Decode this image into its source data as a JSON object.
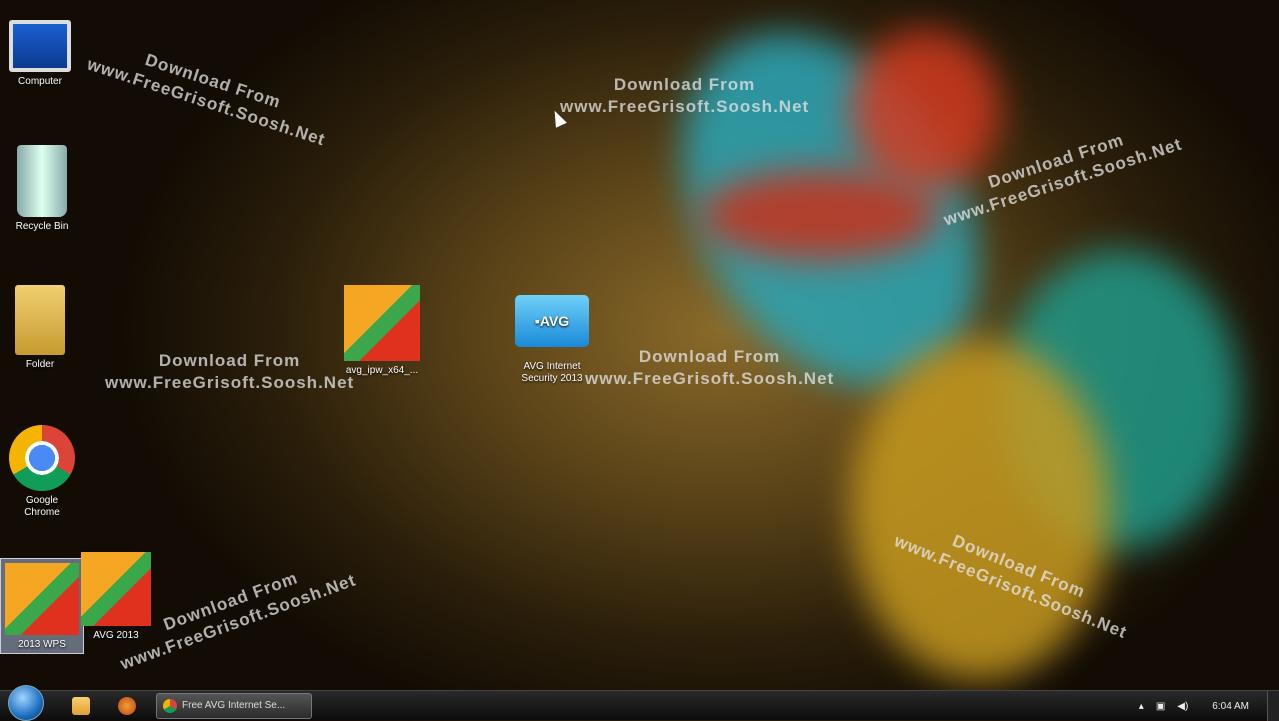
{
  "desktop": {
    "icons": [
      {
        "label": "Computer",
        "icon": "computer-icon"
      },
      {
        "label": "Recycle Bin",
        "icon": "recycle-bin-icon"
      },
      {
        "label": "Folder",
        "icon": "folder-icon"
      },
      {
        "label": "Google Chrome",
        "icon": "chrome-icon"
      },
      {
        "label": "2013 WPS",
        "icon": "avg-icon"
      },
      {
        "label": "AVG 2013",
        "icon": "avg-icon"
      },
      {
        "label": "avg_ipw_x64_...",
        "icon": "avg-installer-icon"
      },
      {
        "label": "AVG Internet Security 2013",
        "icon": "avg-folder-icon"
      }
    ],
    "watermark_line1": "Download From",
    "watermark_line2": "www.FreeGrisoft.Soosh.Net"
  },
  "taskbar": {
    "active_task": "Free AVG Internet Se...",
    "clock": "6:04 AM"
  }
}
